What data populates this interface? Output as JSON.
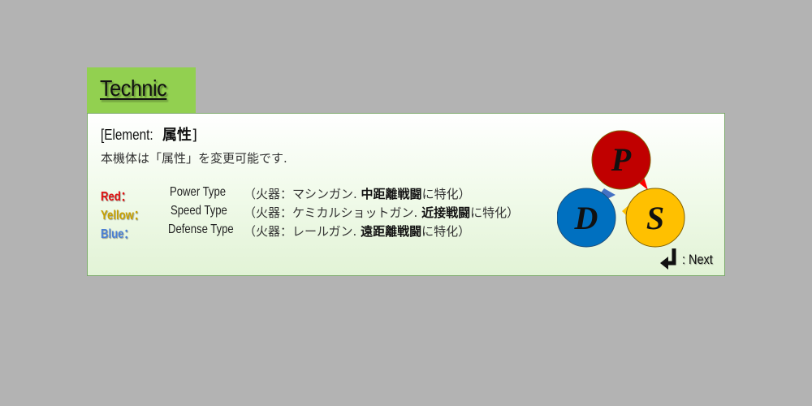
{
  "tab": {
    "title": "Technic"
  },
  "panel": {
    "heading_en": "[Element: ",
    "heading_jp": "属性",
    "heading_close": "]",
    "description": "本機体は「属性」を変更可能です.",
    "rows": [
      {
        "label": "Red：",
        "label_color": "#e01010",
        "type": "Power Type",
        "detail_prefix": "（火器：マシンガン. ",
        "detail_bold": "中距離戦闘",
        "detail_suffix": "に特化）"
      },
      {
        "label": "Yellow：",
        "label_color": "#c8a000",
        "type": "Speed Type",
        "detail_prefix": "（火器：ケミカルショットガン. ",
        "detail_bold": "近接戦闘",
        "detail_suffix": "に特化）"
      },
      {
        "label": "Blue：",
        "label_color": "#4a7fd4",
        "type": "Defense Type",
        "detail_prefix": "（火器：レールガン. ",
        "detail_bold": "遠距離戦闘",
        "detail_suffix": "に特化）"
      }
    ]
  },
  "diagram": {
    "nodes": [
      {
        "letter": "P",
        "color": "#c00000"
      },
      {
        "letter": "D",
        "color": "#0070c0"
      },
      {
        "letter": "S",
        "color": "#ffc000"
      }
    ],
    "arrows": [
      {
        "name": "arrow-p-to-s",
        "color": "#ff0000"
      },
      {
        "name": "arrow-s-to-d",
        "color": "#ffc000"
      },
      {
        "name": "arrow-d-to-p",
        "color": "#4472c4"
      }
    ]
  },
  "next": {
    "label": ": Next",
    "icon": "return-arrow-icon"
  }
}
